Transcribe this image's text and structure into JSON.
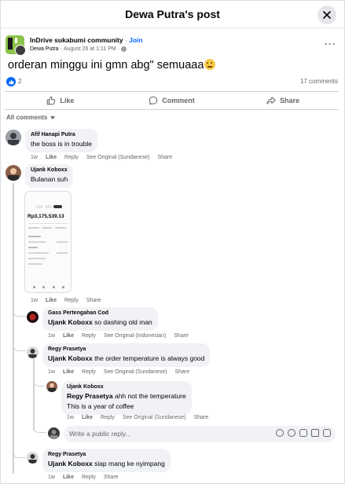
{
  "dialog": {
    "title": "Dewa Putra's post"
  },
  "post": {
    "group_name": "InDrive sukabumi community",
    "join_label": "Join",
    "author": "Dewa Putra",
    "date": "August 26 at 1:11 PM",
    "text": "orderan minggu ini gmn abg\" semuaaa",
    "reaction_count": "2",
    "comment_count": "17 comments"
  },
  "actions": {
    "like": "Like",
    "comment": "Comment",
    "share": "Share"
  },
  "filter_label": "All comments",
  "comments": [
    {
      "name": "Afif Hanapi Putra",
      "text": "the boss is in trouble",
      "time": "1w",
      "like": "Like",
      "reply": "Reply",
      "see_original": "See Original (Sundanese)",
      "share": "Share"
    },
    {
      "name": "Ujank Koboxx",
      "text": "Bulanan suh",
      "time": "1w",
      "like": "Like",
      "reply": "Reply",
      "share": "Share",
      "attachment": {
        "amount": "Rp3,175,539.13"
      }
    },
    {
      "name": "Gass Pertengahan Cod",
      "mention": "Ujank Koboxx",
      "text": "so dashing old man",
      "time": "1w",
      "like": "Like",
      "reply": "Reply",
      "see_original": "See Original (Indonesian)",
      "share": "Share"
    },
    {
      "name": "Regy Prasetya",
      "mention": "Ujank Koboxx",
      "text": "the order temperature is always good",
      "time": "1w",
      "like": "Like",
      "reply": "Reply",
      "see_original": "See Original (Sundanese)",
      "share": "Share"
    },
    {
      "name": "Ujank Koboxx",
      "mention": "Regy Prasetya",
      "text": "ahh not the temperature",
      "text2": "This is a year of coffee",
      "time": "1w",
      "like": "Like",
      "reply": "Reply",
      "see_original": "See Original (Sundanese)",
      "share": "Share"
    },
    {
      "name": "Regy Prasetya",
      "mention": "Ujank Koboxx",
      "text": "siap mang ke nyimpang",
      "time": "1w",
      "like": "Like",
      "reply": "Reply",
      "share": "Share"
    }
  ],
  "reply_box": {
    "placeholder": "Write a public reply..."
  },
  "colors": {
    "accent": "#0866ff",
    "bubble": "#f0f2f5",
    "secondary_text": "#65676b"
  }
}
